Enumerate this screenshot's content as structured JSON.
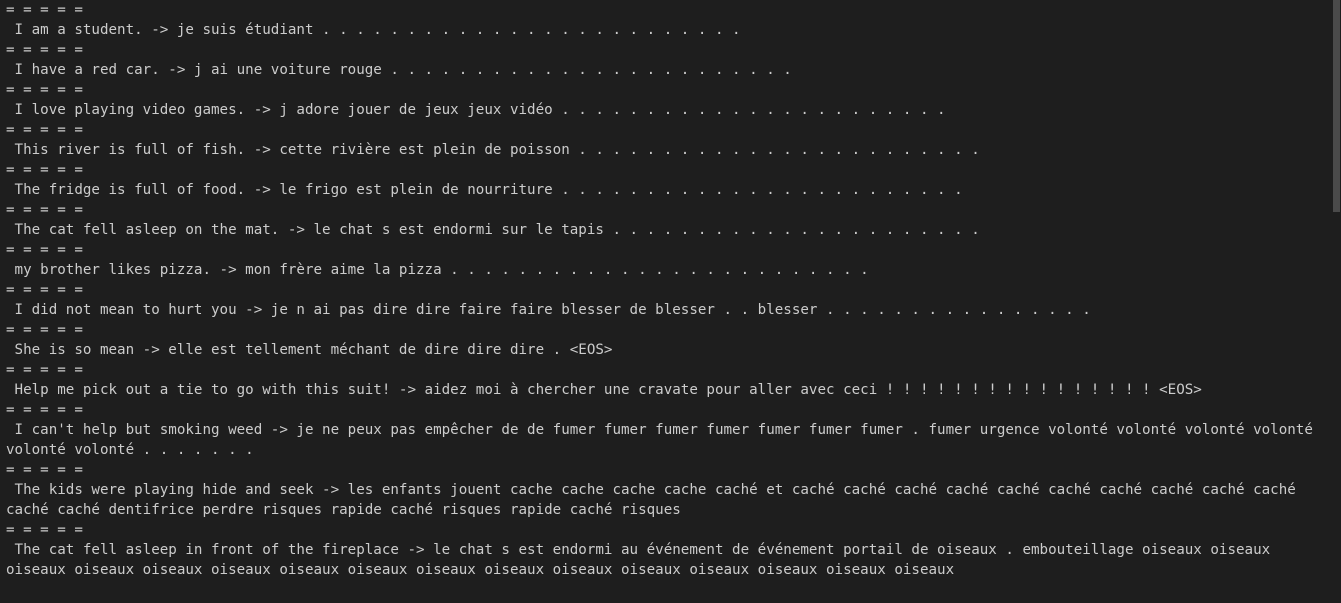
{
  "separator": "= = = = =",
  "results": [
    {
      "text": " I am a student. -> je suis étudiant . . . . . . . . . . . . . . . . . . . . . . . . ."
    },
    {
      "text": " I have a red car. -> j ai une voiture rouge . . . . . . . . . . . . . . . . . . . . . . . ."
    },
    {
      "text": " I love playing video games. -> j adore jouer de jeux jeux vidéo . . . . . . . . . . . . . . . . . . . . . . ."
    },
    {
      "text": " This river is full of fish. -> cette rivière est plein de poisson . . . . . . . . . . . . . . . . . . . . . . . ."
    },
    {
      "text": " The fridge is full of food. -> le frigo est plein de nourriture . . . . . . . . . . . . . . . . . . . . . . . ."
    },
    {
      "text": " The cat fell asleep on the mat. -> le chat s est endormi sur le tapis . . . . . . . . . . . . . . . . . . . . . ."
    },
    {
      "text": " my brother likes pizza. -> mon frère aime la pizza . . . . . . . . . . . . . . . . . . . . . . . . ."
    },
    {
      "text": " I did not mean to hurt you -> je n ai pas dire dire faire faire blesser de blesser . . blesser . . . . . . . . . . . . . . . ."
    },
    {
      "text": " She is so mean -> elle est tellement méchant de dire dire dire . <EOS>"
    },
    {
      "text": " Help me pick out a tie to go with this suit! -> aidez moi à chercher une cravate pour aller avec ceci ! ! ! ! ! ! ! ! ! ! ! ! ! ! ! ! <EOS>"
    },
    {
      "text": " I can't help but smoking weed -> je ne peux pas empêcher de de fumer fumer fumer fumer fumer fumer fumer . fumer urgence volonté volonté volonté volonté volonté volonté . . . . . . ."
    },
    {
      "text": " The kids were playing hide and seek -> les enfants jouent cache cache cache cache caché et caché caché caché caché caché caché caché caché caché caché caché caché dentifrice perdre risques rapide caché risques rapide caché risques"
    },
    {
      "text": " The cat fell asleep in front of the fireplace -> le chat s est endormi au événement de événement portail de oiseaux . embouteillage oiseaux oiseaux oiseaux oiseaux oiseaux oiseaux oiseaux oiseaux oiseaux oiseaux oiseaux oiseaux oiseaux oiseaux oiseaux oiseaux"
    }
  ]
}
